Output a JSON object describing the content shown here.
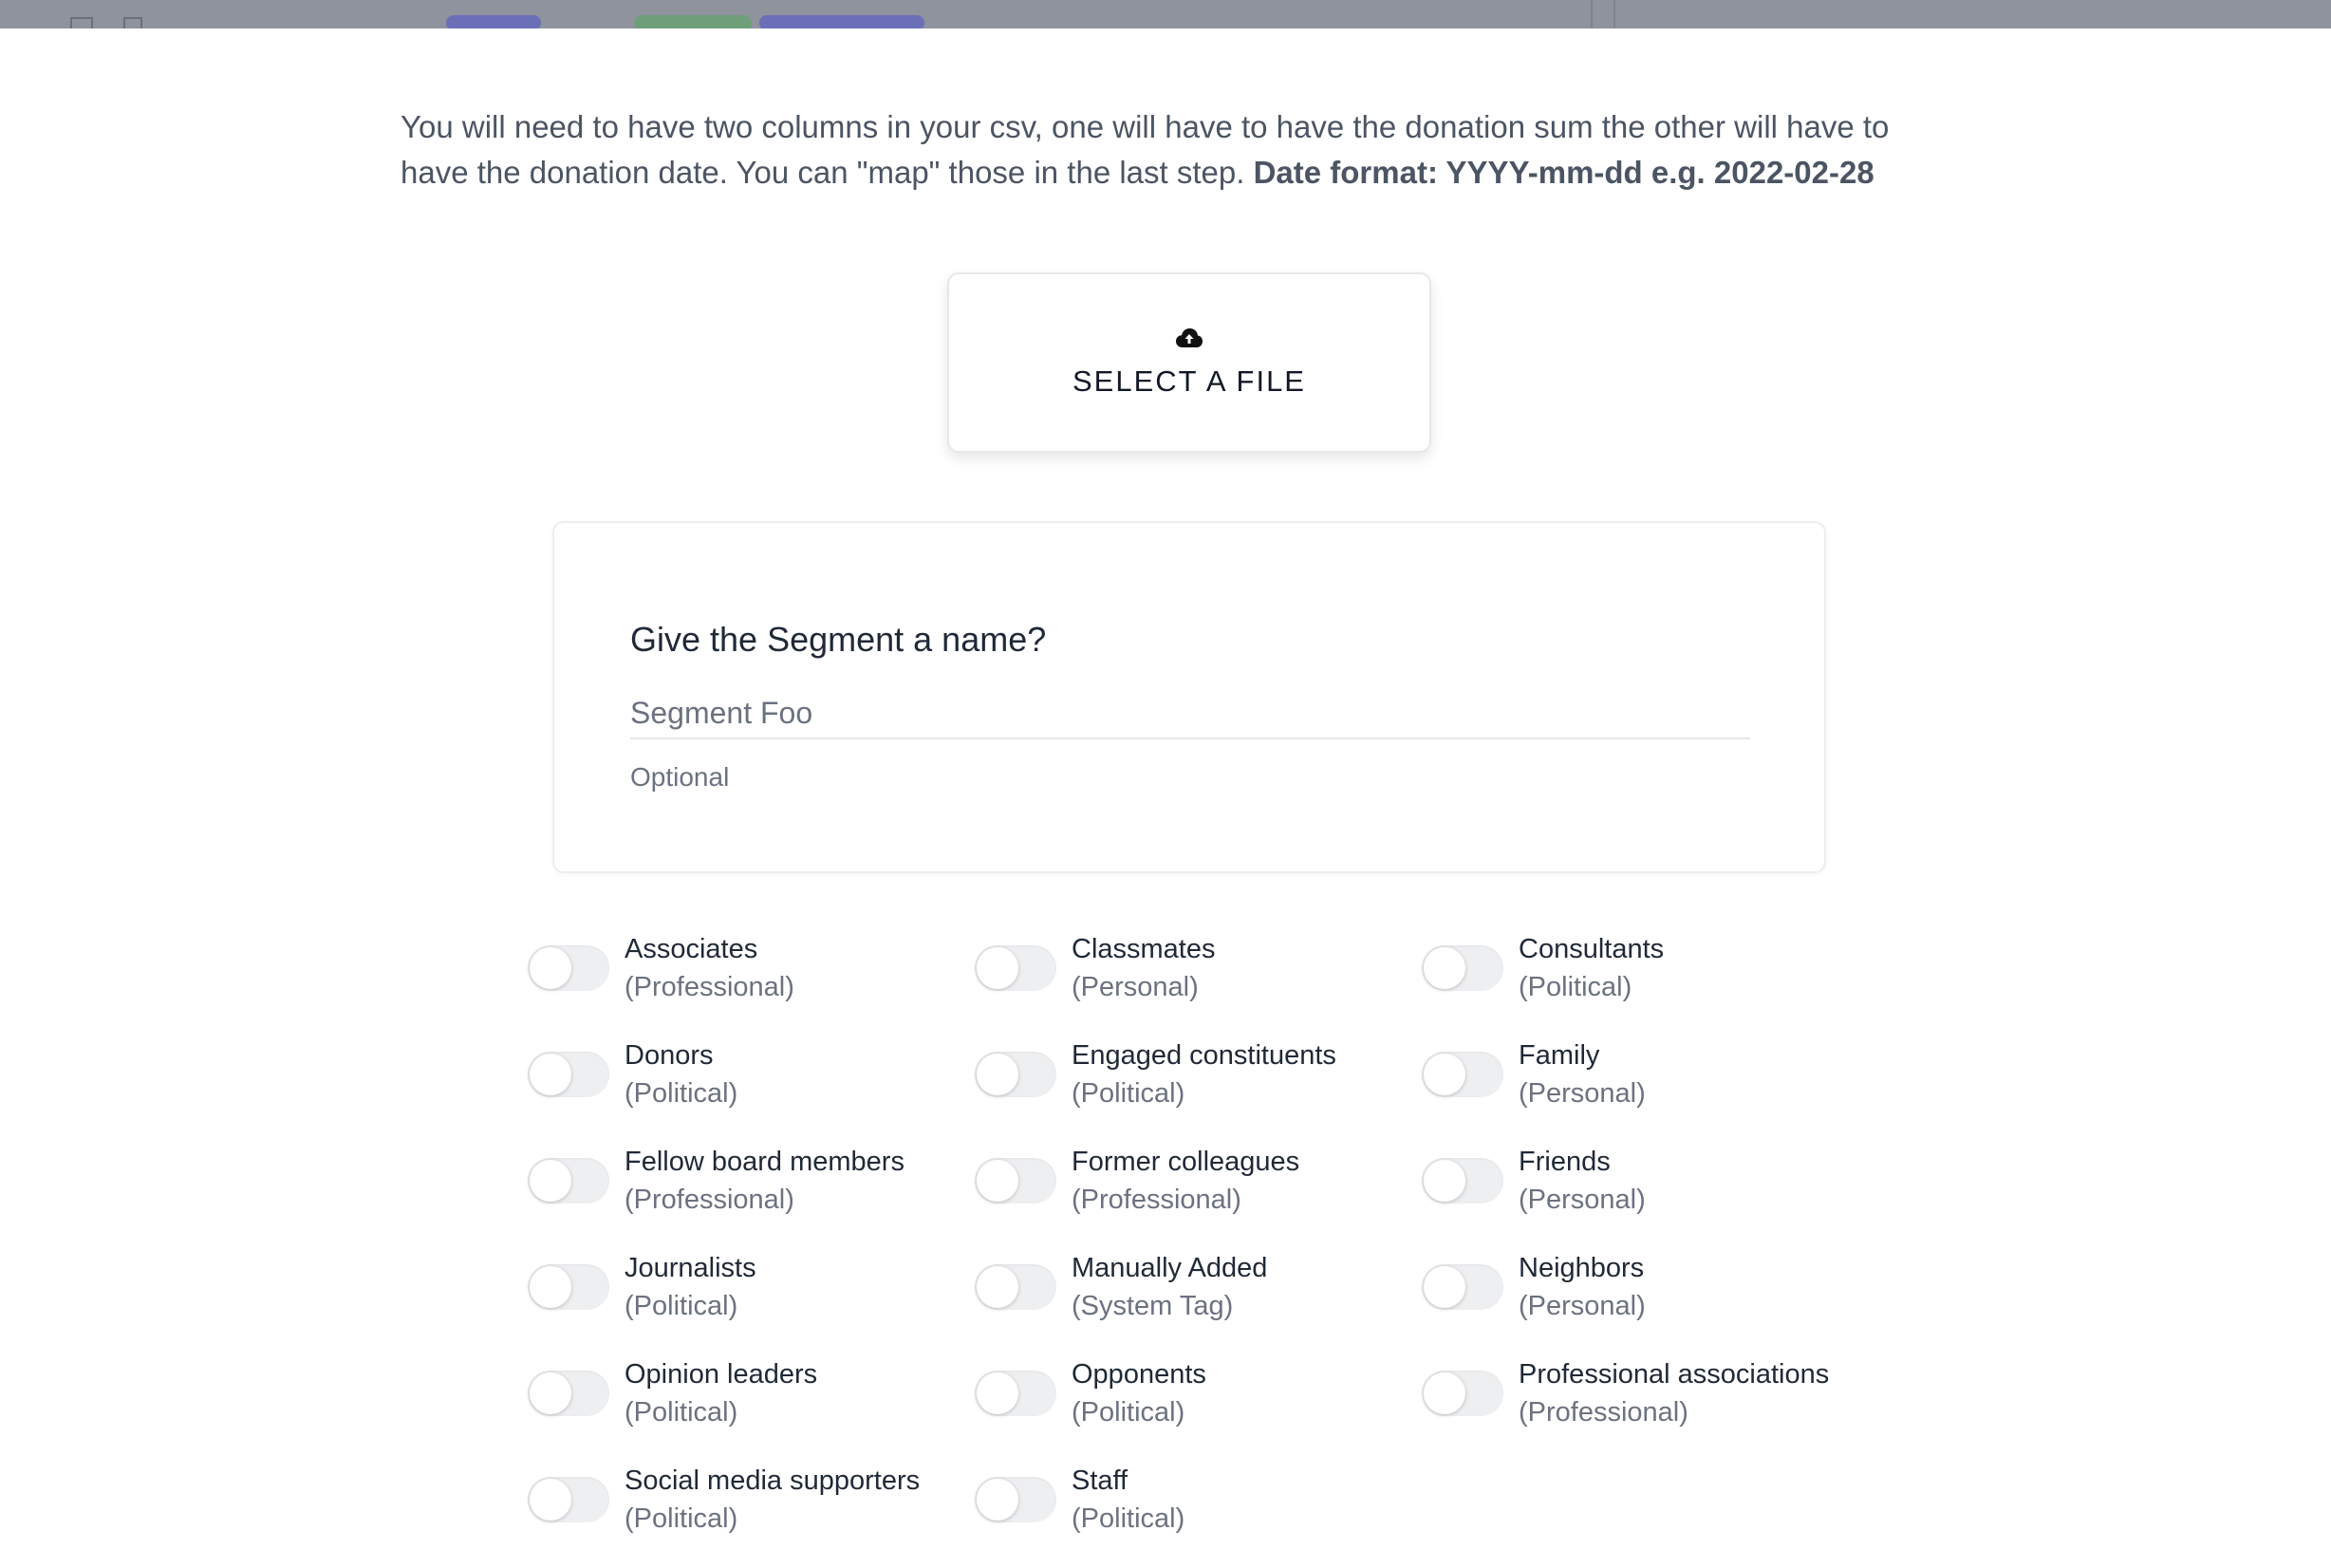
{
  "intro": {
    "text": "You will need to have two columns in your csv, one will have to have the donation sum the other will have to have the donation date. You can \"map\" those in the last step. ",
    "date_format": "Date format: YYYY-mm-dd e.g. 2022-02-28"
  },
  "upload": {
    "label": "SELECT A FILE",
    "icon": "cloud-upload-icon"
  },
  "segment": {
    "question": "Give the Segment a name?",
    "placeholder": "Segment Foo",
    "value": "",
    "hint": "Optional"
  },
  "tags": [
    {
      "name": "Associates",
      "category": "(Professional)",
      "enabled": false
    },
    {
      "name": "Classmates",
      "category": "(Personal)",
      "enabled": false
    },
    {
      "name": "Consultants",
      "category": "(Political)",
      "enabled": false
    },
    {
      "name": "Donors",
      "category": "(Political)",
      "enabled": false
    },
    {
      "name": "Engaged constituents",
      "category": "(Political)",
      "enabled": false
    },
    {
      "name": "Family",
      "category": "(Personal)",
      "enabled": false
    },
    {
      "name": "Fellow board members",
      "category": "(Professional)",
      "enabled": false
    },
    {
      "name": "Former colleagues",
      "category": "(Professional)",
      "enabled": false
    },
    {
      "name": "Friends",
      "category": "(Personal)",
      "enabled": false
    },
    {
      "name": "Journalists",
      "category": "(Political)",
      "enabled": false
    },
    {
      "name": "Manually Added",
      "category": "(System Tag)",
      "enabled": false
    },
    {
      "name": "Neighbors",
      "category": "(Personal)",
      "enabled": false
    },
    {
      "name": "Opinion leaders",
      "category": "(Political)",
      "enabled": false
    },
    {
      "name": "Opponents",
      "category": "(Political)",
      "enabled": false
    },
    {
      "name": "Professional associations",
      "category": "(Professional)",
      "enabled": false
    },
    {
      "name": "Social media supporters",
      "category": "(Political)",
      "enabled": false
    },
    {
      "name": "Staff",
      "category": "(Political)",
      "enabled": false
    }
  ]
}
